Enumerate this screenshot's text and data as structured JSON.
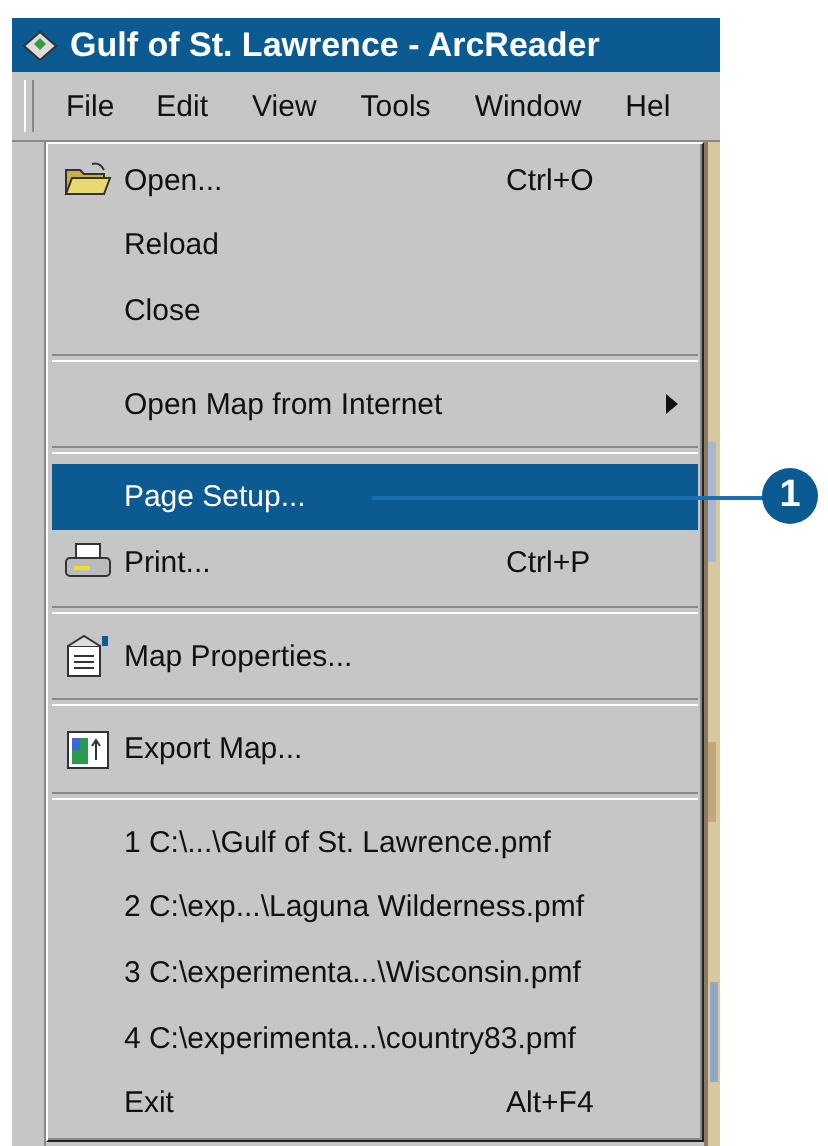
{
  "window": {
    "title": "Gulf of St. Lawrence - ArcReader"
  },
  "menubar": [
    {
      "label": "File",
      "selected": true
    },
    {
      "label": "Edit",
      "selected": false
    },
    {
      "label": "View",
      "selected": false
    },
    {
      "label": "Tools",
      "selected": false
    },
    {
      "label": "Window",
      "selected": false
    },
    {
      "label": "Hel",
      "selected": false
    }
  ],
  "menu": [
    {
      "kind": "open",
      "label": "Open...",
      "shortcut": "Ctrl+O",
      "selected": false
    },
    {
      "kind": "item",
      "label": "Reload",
      "selected": false
    },
    {
      "kind": "item",
      "label": "Close",
      "selected": false
    },
    {
      "kind": "separator"
    },
    {
      "kind": "submenu",
      "label": "Open Map from Internet",
      "selected": false
    },
    {
      "kind": "separator"
    },
    {
      "kind": "item",
      "label": "Page Setup...",
      "selected": true
    },
    {
      "kind": "print",
      "label": "Print...",
      "shortcut": "Ctrl+P",
      "selected": false
    },
    {
      "kind": "separator"
    },
    {
      "kind": "properties",
      "label": "Map Properties...",
      "selected": false
    },
    {
      "kind": "separator"
    },
    {
      "kind": "export",
      "label": "Export Map...",
      "selected": false
    },
    {
      "kind": "separator"
    },
    {
      "kind": "item",
      "label": "1 C:\\...\\Gulf of St. Lawrence.pmf",
      "selected": false
    },
    {
      "kind": "item",
      "label": "2 C:\\exp...\\Laguna Wilderness.pmf",
      "selected": false
    },
    {
      "kind": "item",
      "label": "3 C:\\experimenta...\\Wisconsin.pmf",
      "selected": false
    },
    {
      "kind": "item",
      "label": "4 C:\\experimenta...\\country83.pmf",
      "selected": false
    },
    {
      "kind": "item",
      "label": "Exit",
      "shortcut": "Alt+F4",
      "selected": false
    }
  ],
  "callout": {
    "number": "1"
  }
}
